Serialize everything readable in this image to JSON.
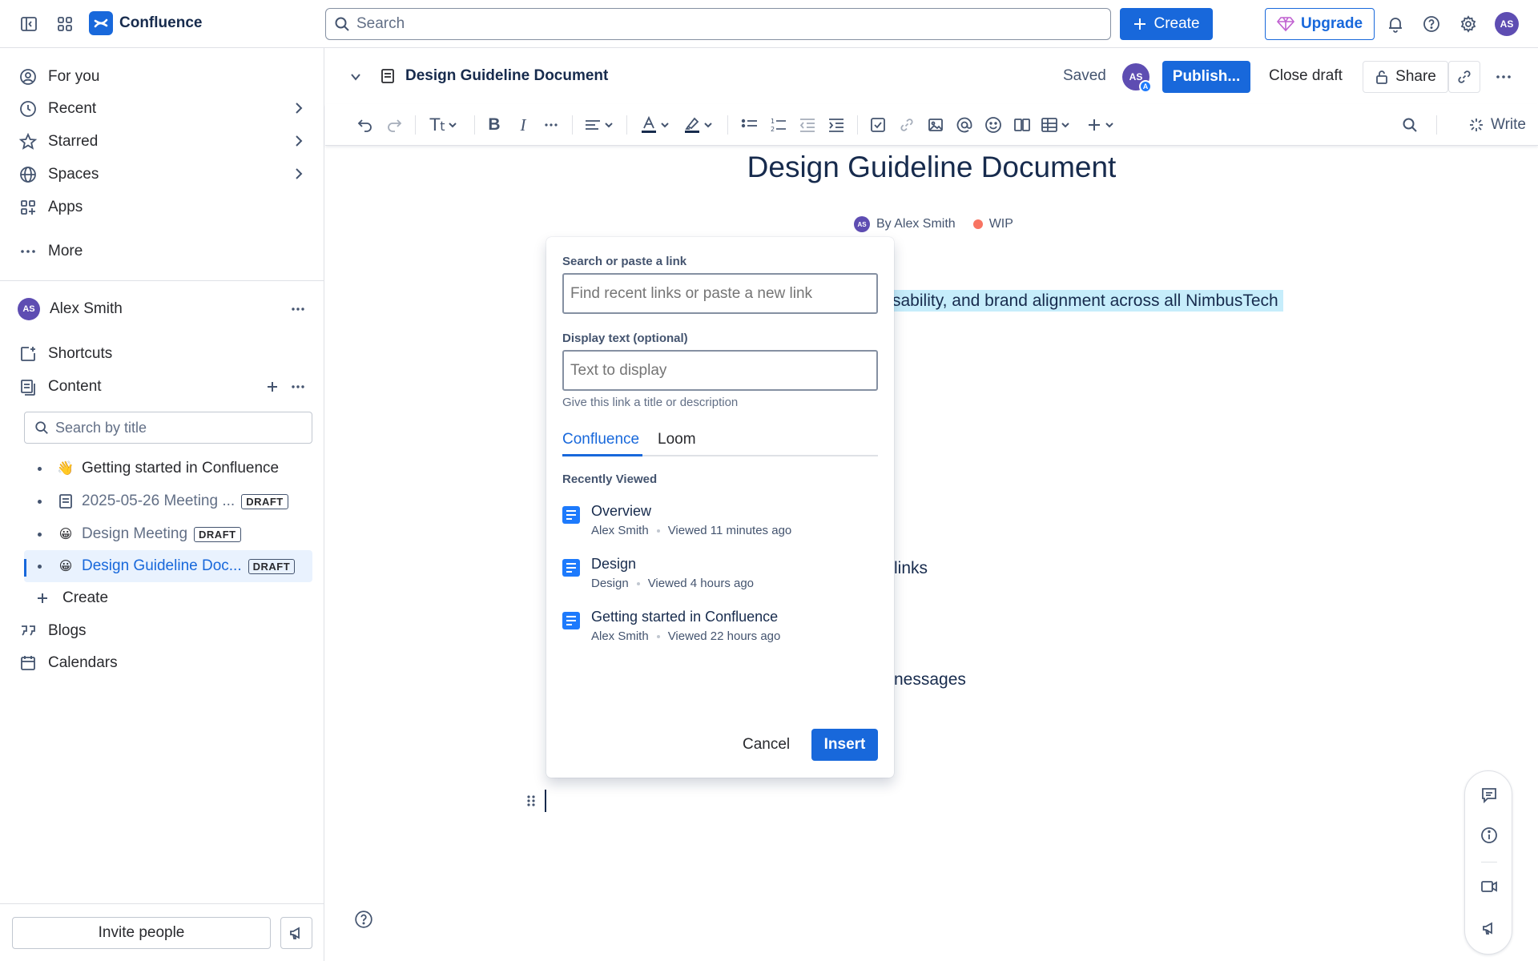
{
  "topbar": {
    "app_name": "Confluence",
    "search_placeholder": "Search",
    "create_label": "Create",
    "upgrade_label": "Upgrade",
    "avatar_initials": "AS",
    "brand_color": "#1868db"
  },
  "sidebar": {
    "nav": [
      {
        "label": "For you",
        "icon": "person-circle-icon"
      },
      {
        "label": "Recent",
        "icon": "clock-icon"
      },
      {
        "label": "Starred",
        "icon": "star-icon"
      },
      {
        "label": "Spaces",
        "icon": "globe-icon"
      },
      {
        "label": "Apps",
        "icon": "apps-icon"
      },
      {
        "label": "More",
        "icon": "more-icon"
      }
    ],
    "space": {
      "initials": "AS",
      "name": "Alex Smith"
    },
    "shortcuts_label": "Shortcuts",
    "content_label": "Content",
    "search_placeholder": "Search by title",
    "tree": [
      {
        "emoji": "👋",
        "title": "Getting started in Confluence",
        "draft": ""
      },
      {
        "emoji": "",
        "title": "2025-05-26 Meeting ...",
        "draft": "DRAFT"
      },
      {
        "emoji": "😀",
        "title": "Design Meeting",
        "draft": "DRAFT"
      },
      {
        "emoji": "😀",
        "title": "Design Guideline Doc...",
        "draft": "DRAFT"
      }
    ],
    "create_label": "Create",
    "blogs_label": "Blogs",
    "calendars_label": "Calendars",
    "invite_label": "Invite people"
  },
  "page_header": {
    "title": "Design Guideline Document",
    "saved_label": "Saved",
    "collab_initials": "AS",
    "collab_badge": "A",
    "publish_label": "Publish...",
    "close_draft_label": "Close draft",
    "share_label": "Share"
  },
  "toolbar": {
    "write_label": "Write"
  },
  "document": {
    "title": "Design Guideline Document",
    "author_initials": "AS",
    "byline": "By Alex Smith",
    "status": "WIP",
    "status_color": "#f87462",
    "line1": "sability, and brand alignment across all NimbusTech",
    "line2": "links",
    "line3": "nessages"
  },
  "link_dialog": {
    "search_label": "Search or paste a link",
    "search_placeholder": "Find recent links or paste a new link",
    "display_label": "Display text (optional)",
    "display_placeholder": "Text to display",
    "display_help": "Give this link a title or description",
    "tabs": [
      "Confluence",
      "Loom"
    ],
    "recent_label": "Recently Viewed",
    "recent": [
      {
        "title": "Overview",
        "owner": "Alex Smith",
        "viewed": "Viewed 11 minutes ago"
      },
      {
        "title": "Design",
        "owner": "Design",
        "viewed": "Viewed 4 hours ago"
      },
      {
        "title": "Getting started in Confluence",
        "owner": "Alex Smith",
        "viewed": "Viewed 22 hours ago"
      }
    ],
    "cancel_label": "Cancel",
    "insert_label": "Insert"
  }
}
